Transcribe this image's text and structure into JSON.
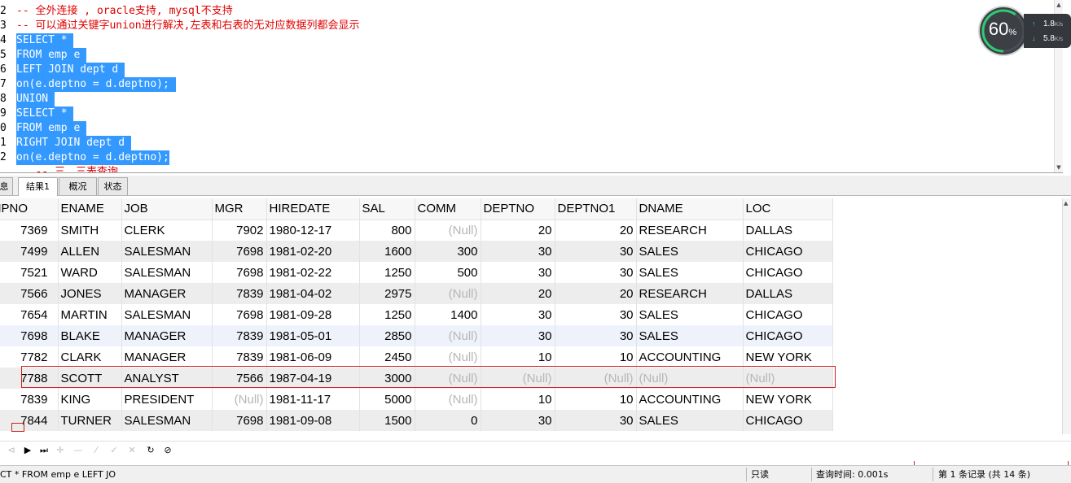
{
  "editor": {
    "lines": [
      {
        "n": "2",
        "text": "-- 全外连接 , oracle支持, mysql不支持",
        "kind": "comment"
      },
      {
        "n": "3",
        "text": "-- 可以通过关键字union进行解决,左表和右表的无对应数据列都会显示",
        "kind": "comment"
      },
      {
        "n": "4",
        "text": "SELECT * ",
        "kind": "sel"
      },
      {
        "n": "5",
        "text": "FROM emp e ",
        "kind": "sel"
      },
      {
        "n": "6",
        "text": "LEFT JOIN dept d ",
        "kind": "sel"
      },
      {
        "n": "7",
        "text": "on(e.deptno = d.deptno); ",
        "kind": "sel"
      },
      {
        "n": "8",
        "text": "UNION ",
        "kind": "sel"
      },
      {
        "n": "9",
        "text": "SELECT * ",
        "kind": "sel"
      },
      {
        "n": "0",
        "text": "FROM emp e ",
        "kind": "sel"
      },
      {
        "n": "1",
        "text": "RIGHT JOIN dept d ",
        "kind": "sel"
      },
      {
        "n": "2",
        "text": "on(e.deptno = d.deptno);",
        "kind": "sel"
      },
      {
        "n": "",
        "text": "   -- 三、三表查询",
        "kind": "comment"
      }
    ]
  },
  "widget": {
    "percent": "60",
    "percent_unit": "%",
    "up_arrow": "↑",
    "up_value": "1.8",
    "up_unit": "K/s",
    "down_arrow": "↓",
    "down_value": "5.8",
    "down_unit": "K/s",
    "ring_fraction": 0.6,
    "ring_color": "#2ecc71"
  },
  "tabs": [
    {
      "label": "息"
    },
    {
      "label": "结果1",
      "active": true
    },
    {
      "label": "概况"
    },
    {
      "label": "状态"
    }
  ],
  "grid": {
    "columns": [
      "MPNO",
      "ENAME",
      "JOB",
      "MGR",
      "HIREDATE",
      "SAL",
      "COMM",
      "DEPTNO",
      "DEPTNO1",
      "DNAME",
      "LOC"
    ],
    "rows": [
      [
        "7369",
        "SMITH",
        "CLERK",
        "7902",
        "1980-12-17",
        "800",
        "(Null)",
        "20",
        "20",
        "RESEARCH",
        "DALLAS"
      ],
      [
        "7499",
        "ALLEN",
        "SALESMAN",
        "7698",
        "1981-02-20",
        "1600",
        "300",
        "30",
        "30",
        "SALES",
        "CHICAGO"
      ],
      [
        "7521",
        "WARD",
        "SALESMAN",
        "7698",
        "1981-02-22",
        "1250",
        "500",
        "30",
        "30",
        "SALES",
        "CHICAGO"
      ],
      [
        "7566",
        "JONES",
        "MANAGER",
        "7839",
        "1981-04-02",
        "2975",
        "(Null)",
        "20",
        "20",
        "RESEARCH",
        "DALLAS"
      ],
      [
        "7654",
        "MARTIN",
        "SALESMAN",
        "7698",
        "1981-09-28",
        "1250",
        "1400",
        "30",
        "30",
        "SALES",
        "CHICAGO"
      ],
      [
        "7698",
        "BLAKE",
        "MANAGER",
        "7839",
        "1981-05-01",
        "2850",
        "(Null)",
        "30",
        "30",
        "SALES",
        "CHICAGO"
      ],
      [
        "7782",
        "CLARK",
        "MANAGER",
        "7839",
        "1981-06-09",
        "2450",
        "(Null)",
        "10",
        "10",
        "ACCOUNTING",
        "NEW YORK"
      ],
      [
        "7788",
        "SCOTT",
        "ANALYST",
        "7566",
        "1987-04-19",
        "3000",
        "(Null)",
        "(Null)",
        "(Null)",
        "(Null)",
        "(Null)"
      ],
      [
        "7839",
        "KING",
        "PRESIDENT",
        "(Null)",
        "1981-11-17",
        "5000",
        "(Null)",
        "10",
        "10",
        "ACCOUNTING",
        "NEW YORK"
      ],
      [
        "7844",
        "TURNER",
        "SALESMAN",
        "7698",
        "1981-09-08",
        "1500",
        "0",
        "30",
        "30",
        "SALES",
        "CHICAGO"
      ]
    ]
  },
  "toolbar": {
    "icons": [
      {
        "name": "first-record-icon",
        "glyph": "⊲",
        "disabled": true
      },
      {
        "name": "next-record-icon",
        "glyph": "▶",
        "disabled": false
      },
      {
        "name": "last-record-icon",
        "glyph": "⏭",
        "disabled": false
      },
      {
        "name": "add-record-icon",
        "glyph": "✛",
        "disabled": true
      },
      {
        "name": "delete-record-icon",
        "glyph": "—",
        "disabled": true
      },
      {
        "name": "edit-record-icon",
        "glyph": "⁄",
        "disabled": true
      },
      {
        "name": "apply-changes-icon",
        "glyph": "✓",
        "disabled": true
      },
      {
        "name": "discard-changes-icon",
        "glyph": "✕",
        "disabled": true
      },
      {
        "name": "refresh-icon",
        "glyph": "↻",
        "disabled": false
      },
      {
        "name": "stop-icon",
        "glyph": "⊘",
        "disabled": false
      }
    ]
  },
  "status": {
    "sql": "CT * FROM emp e LEFT JO",
    "mode": "只读",
    "query_time": "查询时间: 0.001s",
    "record": "第 1 条记录 (共 14 条)"
  }
}
